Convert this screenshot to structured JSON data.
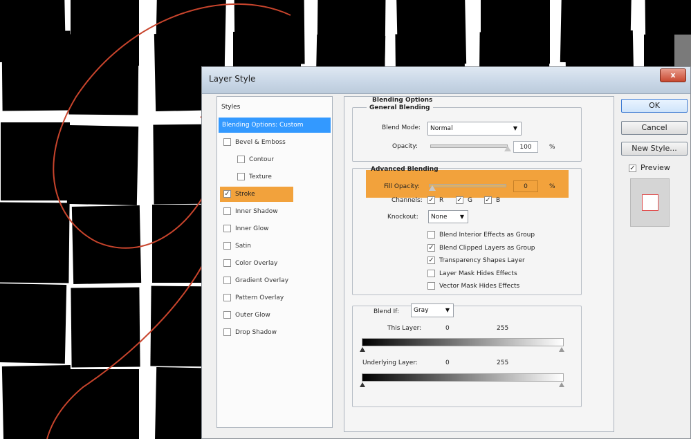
{
  "dialog": {
    "title": "Layer Style",
    "close": "x"
  },
  "styles_list": {
    "header": "Styles",
    "items": [
      {
        "label": "Blending Options: Custom",
        "checkbox": false,
        "checked": false,
        "active": true
      },
      {
        "label": "Bevel & Emboss",
        "checkbox": true,
        "checked": false
      },
      {
        "label": "Contour",
        "checkbox": true,
        "checked": false,
        "indent": true
      },
      {
        "label": "Texture",
        "checkbox": true,
        "checked": false,
        "indent": true
      },
      {
        "label": "Stroke",
        "checkbox": true,
        "checked": true,
        "highlight": true
      },
      {
        "label": "Inner Shadow",
        "checkbox": true,
        "checked": false
      },
      {
        "label": "Inner Glow",
        "checkbox": true,
        "checked": false
      },
      {
        "label": "Satin",
        "checkbox": true,
        "checked": false
      },
      {
        "label": "Color Overlay",
        "checkbox": true,
        "checked": false
      },
      {
        "label": "Gradient Overlay",
        "checkbox": true,
        "checked": false
      },
      {
        "label": "Pattern Overlay",
        "checkbox": true,
        "checked": false
      },
      {
        "label": "Outer Glow",
        "checkbox": true,
        "checked": false
      },
      {
        "label": "Drop Shadow",
        "checkbox": true,
        "checked": false
      }
    ]
  },
  "blending": {
    "heading": "Blending Options",
    "general": {
      "heading": "General Blending",
      "blend_mode_label": "Blend Mode:",
      "blend_mode_value": "Normal",
      "opacity_label": "Opacity:",
      "opacity_value": "100",
      "opacity_unit": "%",
      "opacity_level": 1.0
    },
    "advanced": {
      "heading": "Advanced Blending",
      "fill_opacity_label": "Fill Opacity:",
      "fill_opacity_value": "0",
      "fill_opacity_unit": "%",
      "fill_opacity_level": 0.0,
      "channels_label": "Channels:",
      "channels": [
        {
          "label": "R",
          "checked": true
        },
        {
          "label": "G",
          "checked": true
        },
        {
          "label": "B",
          "checked": true
        }
      ],
      "knockout_label": "Knockout:",
      "knockout_value": "None",
      "options": [
        {
          "label": "Blend Interior Effects as Group",
          "checked": false
        },
        {
          "label": "Blend Clipped Layers as Group",
          "checked": true
        },
        {
          "label": "Transparency Shapes Layer",
          "checked": true
        },
        {
          "label": "Layer Mask Hides Effects",
          "checked": false
        },
        {
          "label": "Vector Mask Hides Effects",
          "checked": false
        }
      ]
    },
    "blend_if": {
      "label": "Blend If:",
      "value": "Gray",
      "this_layer_label": "This Layer:",
      "this_layer_min": "0",
      "this_layer_max": "255",
      "underlying_label": "Underlying Layer:",
      "underlying_min": "0",
      "underlying_max": "255"
    }
  },
  "buttons": {
    "ok": "OK",
    "cancel": "Cancel",
    "new_style": "New Style...",
    "preview_label": "Preview",
    "preview_checked": true
  },
  "colors": {
    "accent_highlight": "#f2a23c",
    "selection_blue": "#3399ff",
    "annotation_red": "#c8442c"
  }
}
